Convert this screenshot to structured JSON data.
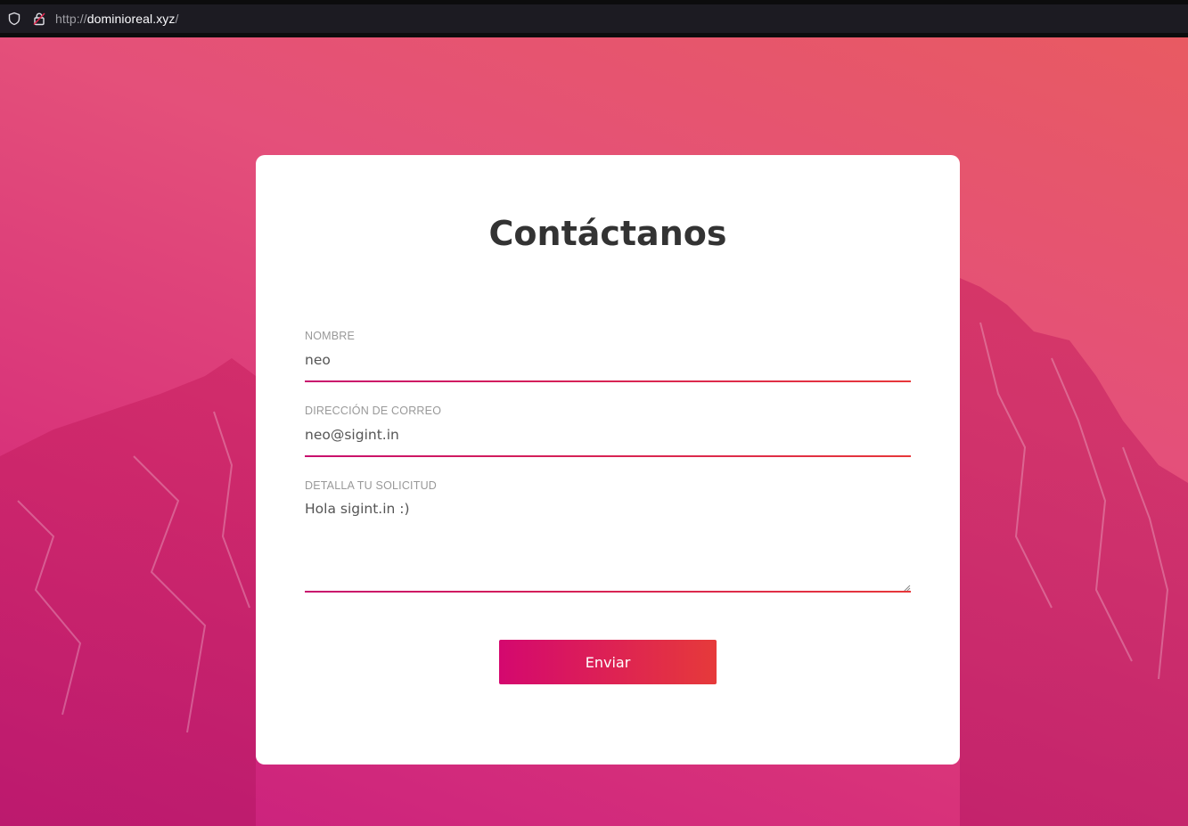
{
  "browser": {
    "url_scheme": "http://",
    "url_host": "dominioreal.xyz",
    "url_tail": "/"
  },
  "form": {
    "title": "Contáctanos",
    "fields": [
      {
        "label": "NOMBRE",
        "value": "neo"
      },
      {
        "label": "DIRECCIÓN DE CORREO",
        "value": "neo@sigint.in"
      },
      {
        "label": "DETALLA TU SOLICITUD",
        "value": "Hola sigint.in :)"
      }
    ],
    "submit_label": "Enviar"
  },
  "colors": {
    "accent_start": "#d4086f",
    "accent_end": "#e63a3a",
    "title": "#333333",
    "label": "#999999"
  },
  "icons": [
    "shield-icon",
    "insecure-lock-icon",
    "resize-grip-icon"
  ]
}
